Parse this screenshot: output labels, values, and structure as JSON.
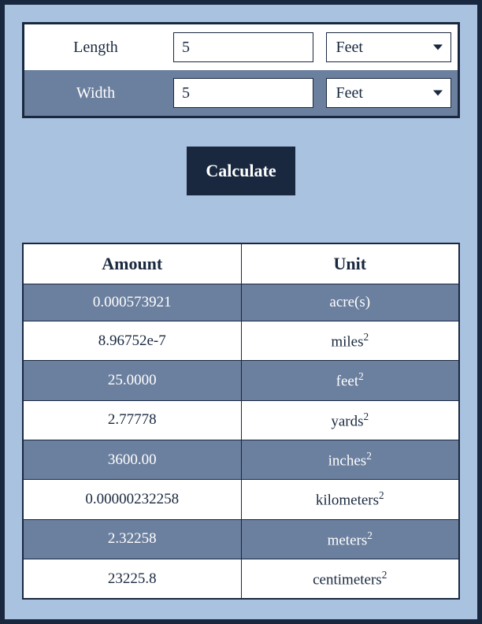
{
  "inputs": {
    "length_label": "Length",
    "length_value": "5",
    "length_unit": "Feet",
    "width_label": "Width",
    "width_value": "5",
    "width_unit": "Feet"
  },
  "calculate_label": "Calculate",
  "results": {
    "headers": {
      "amount": "Amount",
      "unit": "Unit"
    },
    "rows": [
      {
        "amount": "0.000573921",
        "unit": "acre(s)",
        "sq": false
      },
      {
        "amount": "8.96752e-7",
        "unit": "miles",
        "sq": true
      },
      {
        "amount": "25.0000",
        "unit": "feet",
        "sq": true
      },
      {
        "amount": "2.77778",
        "unit": "yards",
        "sq": true
      },
      {
        "amount": "3600.00",
        "unit": "inches",
        "sq": true
      },
      {
        "amount": "0.00000232258",
        "unit": "kilometers",
        "sq": true
      },
      {
        "amount": "2.32258",
        "unit": "meters",
        "sq": true
      },
      {
        "amount": "23225.8",
        "unit": "centimeters",
        "sq": true
      }
    ]
  }
}
